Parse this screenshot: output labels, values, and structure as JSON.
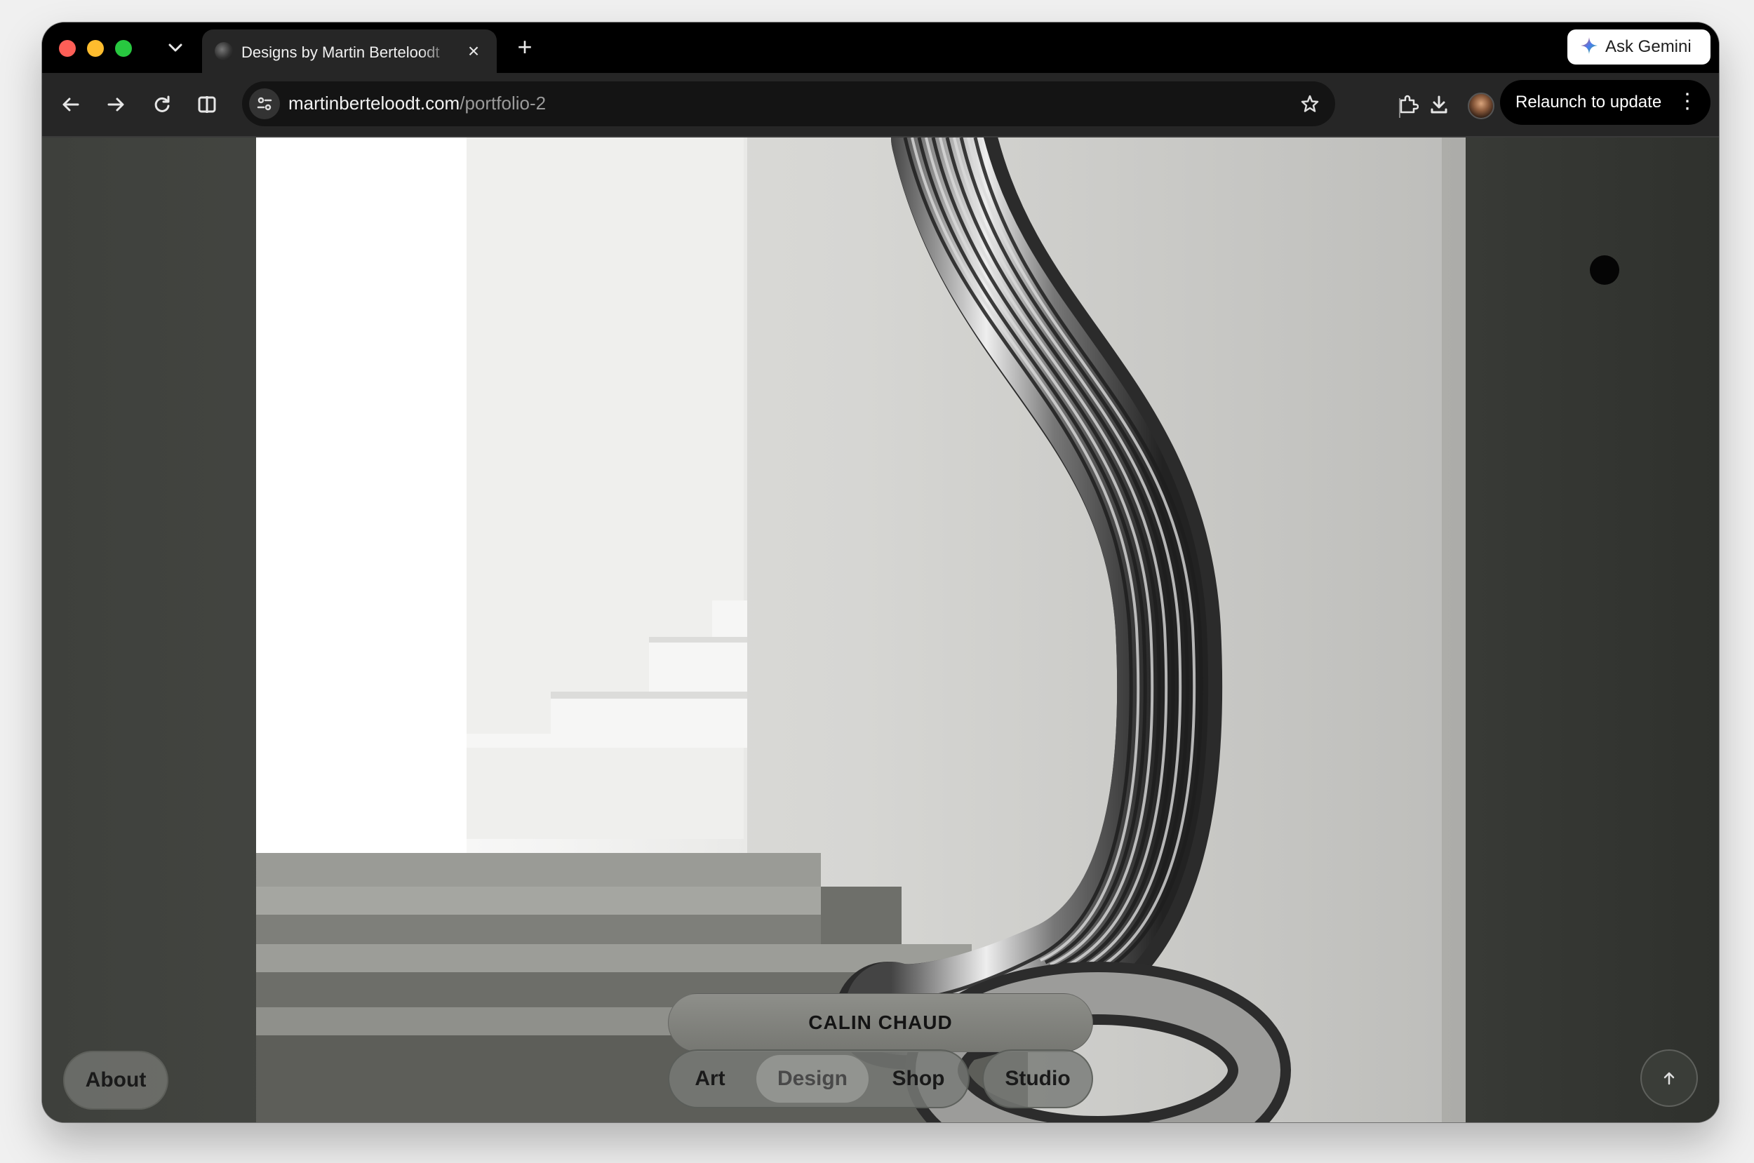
{
  "browser": {
    "tab": {
      "title": "Designs by Martin Berteloodt",
      "close_glyph": "×"
    },
    "new_tab_glyph": "+",
    "tab_list_glyph": "⌄",
    "gemini": {
      "label": "Ask Gemini",
      "icon": "gemini-sparkle-icon"
    },
    "address": {
      "domain": "martinberteloodt.com",
      "path": "/portfolio-2"
    },
    "relaunch": {
      "label": "Relaunch to update",
      "menu_glyph": "⋮"
    },
    "icons": [
      "back-icon",
      "forward-icon",
      "reload-icon",
      "split-view-icon",
      "site-info-icon",
      "bookmark-star-icon",
      "extensions-icon",
      "download-icon",
      "profile-avatar"
    ]
  },
  "site": {
    "about_label": "About",
    "project_title": "CALIN CHAUD",
    "nav": {
      "art": "Art",
      "design": "Design",
      "shop": "Shop",
      "studio": "Studio"
    },
    "active_nav": "Design",
    "scroll_top_glyph": "↑",
    "colors": {
      "page_bg": "#444641",
      "pill_bg": "#787a76",
      "active_pill_bg": "#969894",
      "text": "#1a1a1a"
    }
  }
}
